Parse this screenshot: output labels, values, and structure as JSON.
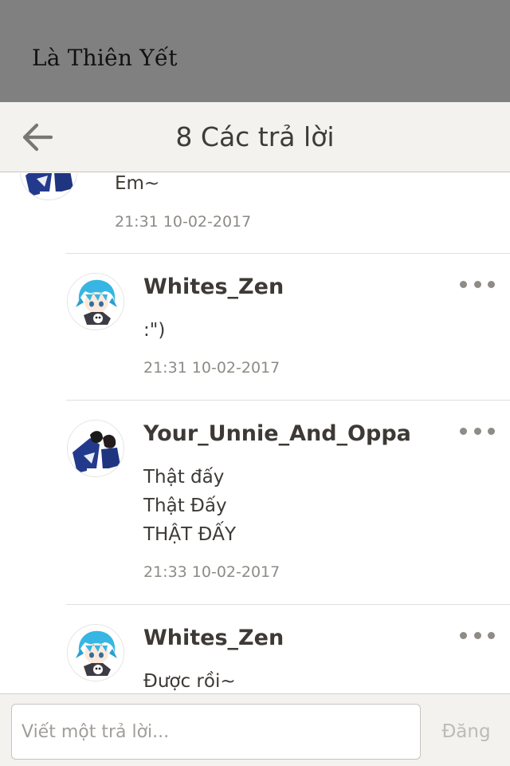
{
  "story": {
    "title": "Là Thiên Yết"
  },
  "nav": {
    "title": "8 Các trả lời",
    "back_icon": "arrow-left-icon"
  },
  "partial_comment": {
    "text": "Em~",
    "time": "21:31 10-02-2017"
  },
  "replies": [
    {
      "username": "Whites_Zen",
      "lines": [
        ":\")"
      ],
      "time": "21:31 10-02-2017",
      "avatar": "blue-hair-anime-avatar"
    },
    {
      "username": "Your_Unnie_And_Oppa",
      "lines": [
        "Thật đấy",
        "Thật Đấy",
        "THẬT ĐẤY"
      ],
      "time": "21:33 10-02-2017",
      "avatar": "couple-anime-avatar"
    },
    {
      "username": "Whites_Zen",
      "lines": [
        "Được rồi~"
      ],
      "time": "",
      "avatar": "blue-hair-anime-avatar"
    }
  ],
  "composer": {
    "placeholder": "Viết một trả lời...",
    "post_label": "Đăng"
  },
  "colors": {
    "top_bar": "#808080",
    "nav_bg": "#f3f2ee",
    "text": "#3d3a36",
    "muted": "#8e8b86"
  }
}
